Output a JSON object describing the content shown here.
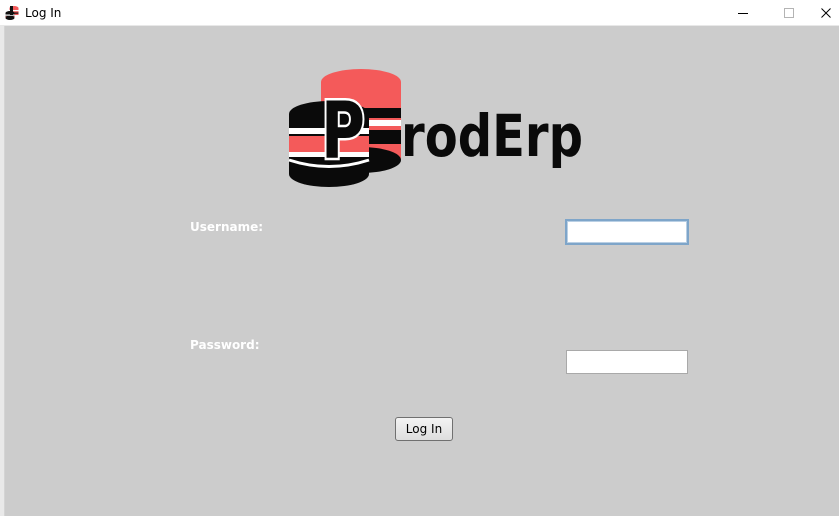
{
  "window": {
    "title": "Log In",
    "app_icon": "proderp-logo-icon",
    "controls": {
      "minimize_icon": "minimize-icon",
      "maximize_icon": "maximize-icon",
      "close_icon": "close-icon"
    }
  },
  "logo": {
    "letter": "P",
    "text": "rodErp",
    "colors": {
      "accent": "#f45a5a",
      "dark": "#0a0a0a",
      "stripe": "#ffffff"
    }
  },
  "form": {
    "username_label": "Username:",
    "username_value": "",
    "password_label": "Password:",
    "password_value": "",
    "login_button": "Log In"
  },
  "colors": {
    "window_background": "#cccccc",
    "label_text": "#ffffff",
    "focus_border": "#7ea5c9"
  }
}
